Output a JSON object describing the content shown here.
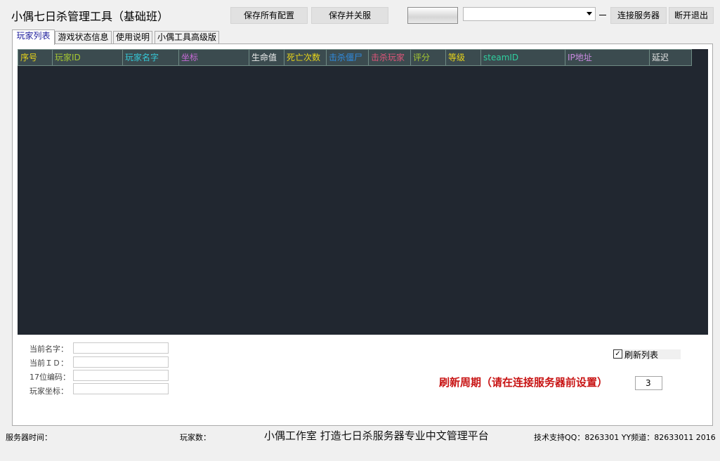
{
  "app": {
    "title": "小偶七日杀管理工具（基础班）"
  },
  "toolbar": {
    "save_all": "保存所有配置",
    "save_shutdown": "保存并关服",
    "progress": 1.0,
    "server_select": "",
    "minus": "—",
    "connect": "连接服务器",
    "disconnect": "断开退出"
  },
  "tabs": [
    {
      "label": "玩家列表",
      "active": true
    },
    {
      "label": "游戏状态信息",
      "active": false
    },
    {
      "label": "使用说明",
      "active": false
    },
    {
      "label": "小偶工具高级版",
      "active": false
    }
  ],
  "grid": {
    "columns": [
      {
        "label": "序号",
        "color": "#e8d41a"
      },
      {
        "label": "玩家ID",
        "color": "#a6c832"
      },
      {
        "label": "玩家名字",
        "color": "#35c9d8"
      },
      {
        "label": "坐标",
        "color": "#c96ad8"
      },
      {
        "label": "生命值",
        "color": "#f0f0f0"
      },
      {
        "label": "死亡次数",
        "color": "#e8d41a"
      },
      {
        "label": "击杀僵尸",
        "color": "#2f8be0"
      },
      {
        "label": "击杀玩家",
        "color": "#e0557a"
      },
      {
        "label": "评分",
        "color": "#a6c832"
      },
      {
        "label": "等级",
        "color": "#e8d41a"
      },
      {
        "label": "steamID",
        "color": "#2fd0a0"
      },
      {
        "label": "IP地址",
        "color": "#c98ae0"
      },
      {
        "label": "延迟",
        "color": "#e0e0e0"
      }
    ],
    "rows": []
  },
  "fields": {
    "current_name": {
      "label": "当前名字：",
      "value": ""
    },
    "current_id": {
      "label": "当前ＩＤ：",
      "value": ""
    },
    "code17": {
      "label": "17位编码：",
      "value": ""
    },
    "player_coord": {
      "label": "玩家坐标：",
      "value": ""
    }
  },
  "refresh": {
    "checkbox_label": "刷新列表",
    "checked": true,
    "period_label": "刷新周期（请在连接服务器前设置）",
    "period_value": "3"
  },
  "statusbar": {
    "server_time": "服务器时间：",
    "player_count": "玩家数：",
    "slogan": "小偶工作室  打造七日杀服务器专业中文管理平台",
    "support": "技术支持QQ：8263301  YY频道：82633011    2016"
  },
  "colors": {
    "grid_bg": "#212730",
    "header_bg": "#3b4b4f",
    "accent_red": "#c81414"
  }
}
